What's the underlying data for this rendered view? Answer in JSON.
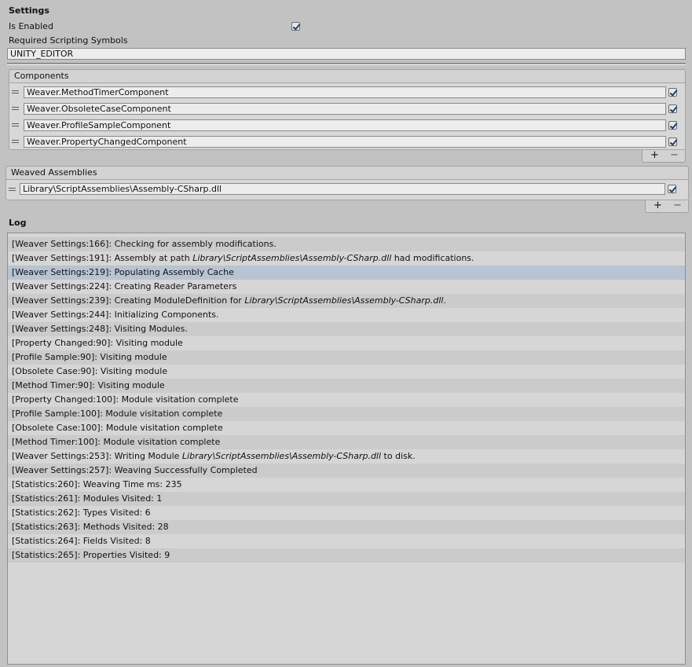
{
  "settings": {
    "title": "Settings",
    "is_enabled_label": "Is Enabled",
    "is_enabled": true,
    "symbols_label": "Required Scripting Symbols",
    "symbols_value": "UNITY_EDITOR"
  },
  "components": {
    "title": "Components",
    "items": [
      {
        "name": "Weaver.MethodTimerComponent",
        "enabled": true
      },
      {
        "name": "Weaver.ObsoleteCaseComponent",
        "enabled": true
      },
      {
        "name": "Weaver.ProfileSampleComponent",
        "enabled": true
      },
      {
        "name": "Weaver.PropertyChangedComponent",
        "enabled": true
      }
    ],
    "add_label": "+",
    "remove_label": "−"
  },
  "weaved_assemblies": {
    "title": "Weaved Assemblies",
    "items": [
      {
        "path": "Library\\ScriptAssemblies\\Assembly-CSharp.dll",
        "enabled": true
      }
    ],
    "add_label": "+",
    "remove_label": "−"
  },
  "log": {
    "title": "Log",
    "selected_index": 2,
    "entries": [
      {
        "prefix": "[Weaver Settings:166]: Checking for assembly modifications.",
        "italic": "",
        "suffix": ""
      },
      {
        "prefix": "[Weaver Settings:191]: Assembly at path ",
        "italic": "Library\\ScriptAssemblies\\Assembly-CSharp.dll",
        "suffix": " had modifications."
      },
      {
        "prefix": "[Weaver Settings:219]: Populating Assembly Cache",
        "italic": "",
        "suffix": ""
      },
      {
        "prefix": "[Weaver Settings:224]: Creating Reader Parameters",
        "italic": "",
        "suffix": ""
      },
      {
        "prefix": "[Weaver Settings:239]: Creating ModuleDefinition for ",
        "italic": "Library\\ScriptAssemblies\\Assembly-CSharp.dll",
        "suffix": "."
      },
      {
        "prefix": "[Weaver Settings:244]: Initializing Components.",
        "italic": "",
        "suffix": ""
      },
      {
        "prefix": "[Weaver Settings:248]: Visiting Modules.",
        "italic": "",
        "suffix": ""
      },
      {
        "prefix": "[Property Changed:90]: Visiting module",
        "italic": "",
        "suffix": ""
      },
      {
        "prefix": "[Profile Sample:90]: Visiting module",
        "italic": "",
        "suffix": ""
      },
      {
        "prefix": "[Obsolete Case:90]: Visiting module",
        "italic": "",
        "suffix": ""
      },
      {
        "prefix": "[Method Timer:90]: Visiting module",
        "italic": "",
        "suffix": ""
      },
      {
        "prefix": "[Property Changed:100]: Module visitation complete",
        "italic": "",
        "suffix": ""
      },
      {
        "prefix": "[Profile Sample:100]: Module visitation complete",
        "italic": "",
        "suffix": ""
      },
      {
        "prefix": "[Obsolete Case:100]: Module visitation complete",
        "italic": "",
        "suffix": ""
      },
      {
        "prefix": "[Method Timer:100]: Module visitation complete",
        "italic": "",
        "suffix": ""
      },
      {
        "prefix": "[Weaver Settings:253]: Writing Module ",
        "italic": "Library\\ScriptAssemblies\\Assembly-CSharp.dll",
        "suffix": " to disk."
      },
      {
        "prefix": "[Weaver Settings:257]: Weaving Successfully Completed",
        "italic": "",
        "suffix": ""
      },
      {
        "prefix": "[Statistics:260]: Weaving Time ms: 235",
        "italic": "",
        "suffix": ""
      },
      {
        "prefix": "[Statistics:261]: Modules Visited: 1",
        "italic": "",
        "suffix": ""
      },
      {
        "prefix": "[Statistics:262]: Types Visited: 6",
        "italic": "",
        "suffix": ""
      },
      {
        "prefix": "[Statistics:263]: Methods Visited: 28",
        "italic": "",
        "suffix": ""
      },
      {
        "prefix": "[Statistics:264]: Fields Visited: 8",
        "italic": "",
        "suffix": ""
      },
      {
        "prefix": "[Statistics:265]: Properties Visited: 9",
        "italic": "",
        "suffix": ""
      }
    ]
  }
}
